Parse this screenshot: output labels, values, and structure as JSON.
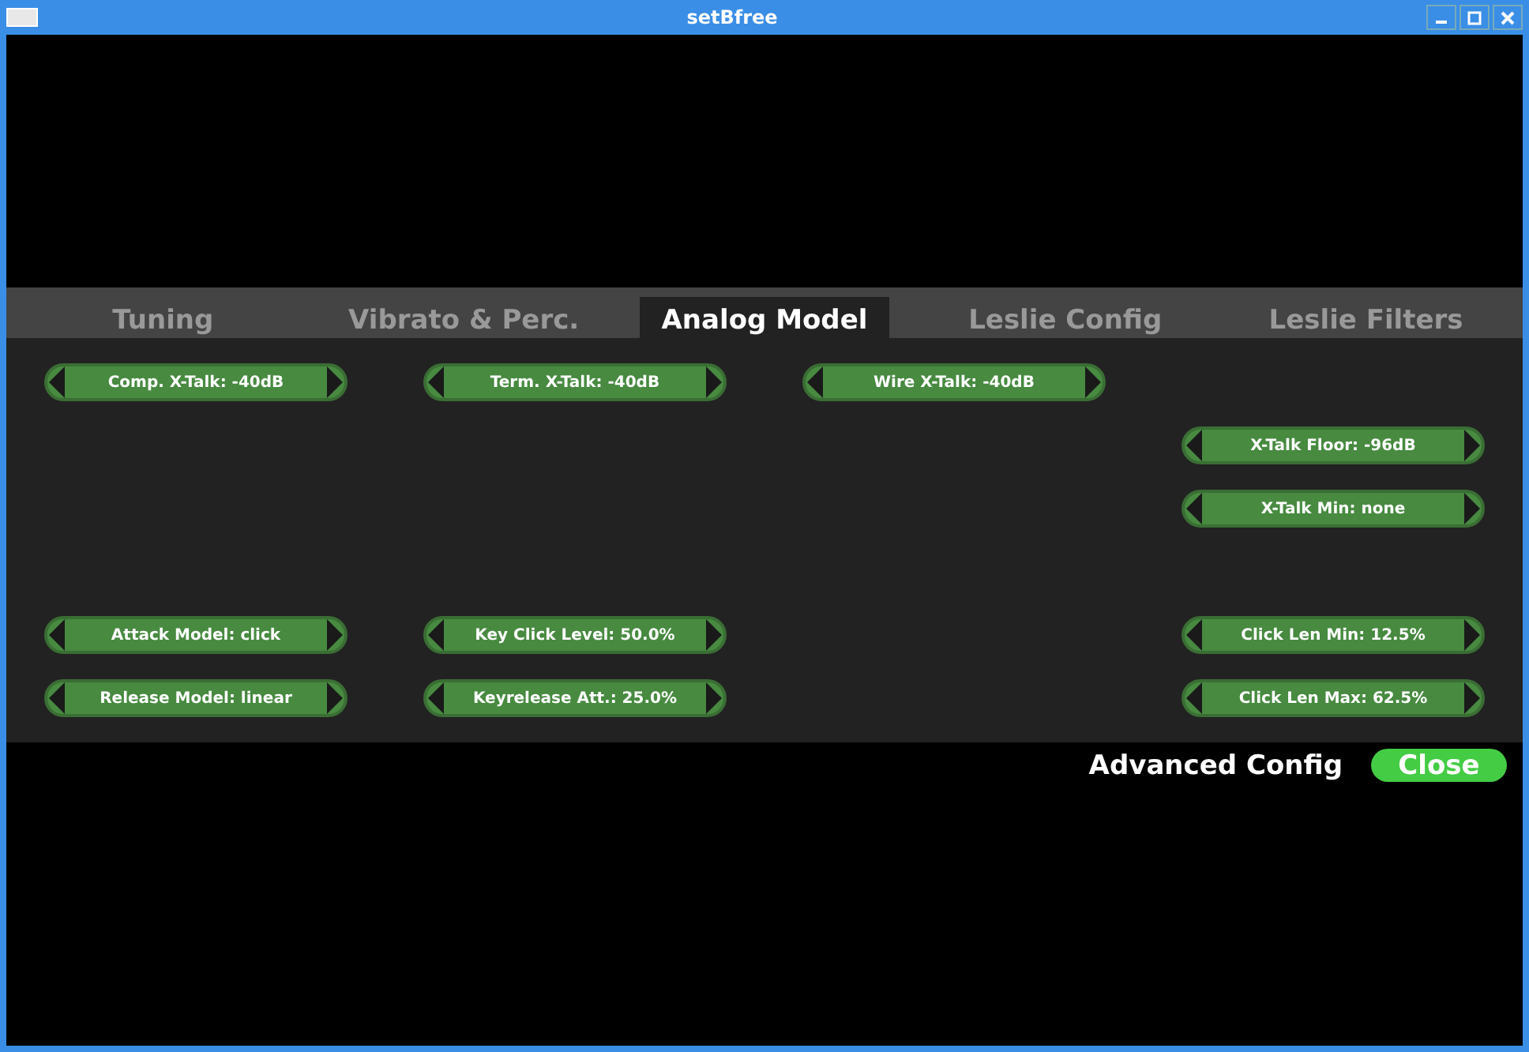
{
  "window": {
    "title": "setBfree"
  },
  "tabs": [
    {
      "label": "Tuning",
      "selected": false
    },
    {
      "label": "Vibrato & Perc.",
      "selected": false
    },
    {
      "label": "Analog Model",
      "selected": true
    },
    {
      "label": "Leslie Config",
      "selected": false
    },
    {
      "label": "Leslie Filters",
      "selected": false
    }
  ],
  "rows": [
    [
      {
        "label": "Comp. X-Talk: -40dB"
      },
      {
        "label": "Term. X-Talk: -40dB"
      },
      {
        "label": "Wire X-Talk: -40dB"
      },
      null
    ],
    [
      null,
      null,
      null,
      {
        "label": "X-Talk Floor: -96dB"
      }
    ],
    [
      null,
      null,
      null,
      {
        "label": "X-Talk Min: none"
      }
    ],
    [
      null,
      null,
      null,
      null
    ],
    [
      {
        "label": "Attack Model: click"
      },
      {
        "label": "Key Click Level: 50.0%"
      },
      null,
      {
        "label": "Click Len Min: 12.5%"
      }
    ],
    [
      {
        "label": "Release Model: linear"
      },
      {
        "label": "Keyrelease Att.: 25.0%"
      },
      null,
      {
        "label": "Click Len Max: 62.5%"
      }
    ]
  ],
  "footer": {
    "title": "Advanced Config",
    "close_button": "Close"
  }
}
